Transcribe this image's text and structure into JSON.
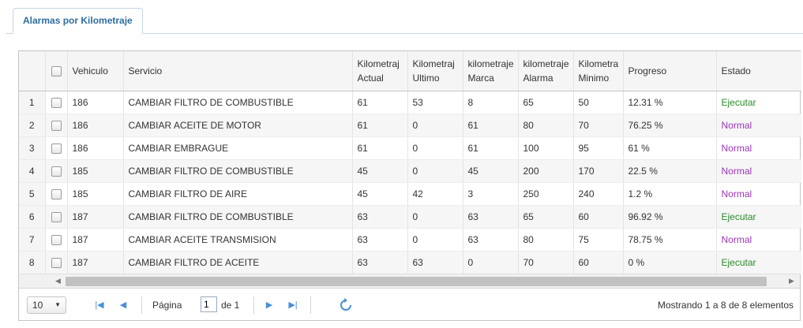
{
  "tab": {
    "label": "Alarmas por Kilometraje"
  },
  "columns": [
    {
      "l1": "",
      "l2": ""
    },
    {
      "l1": "",
      "l2": ""
    },
    {
      "l1": "Vehiculo",
      "l2": ""
    },
    {
      "l1": "Servicio",
      "l2": ""
    },
    {
      "l1": "Kilometraj",
      "l2": "Actual"
    },
    {
      "l1": "Kilometraj",
      "l2": "Ultimo"
    },
    {
      "l1": "kilometraje",
      "l2": "Marca"
    },
    {
      "l1": "kilometraje",
      "l2": "Alarma"
    },
    {
      "l1": "Kilometraj",
      "l2": "Minimo"
    },
    {
      "l1": "Progreso",
      "l2": ""
    },
    {
      "l1": "Estado",
      "l2": ""
    }
  ],
  "rows": [
    {
      "n": "1",
      "vehiculo": "186",
      "servicio": "CAMBIAR FILTRO DE COMBUSTIBLE",
      "actual": "61",
      "ultimo": "53",
      "marca": "8",
      "alarma": "65",
      "minimo": "50",
      "progreso": "12.31 %",
      "estado": "Ejecutar"
    },
    {
      "n": "2",
      "vehiculo": "186",
      "servicio": "CAMBIAR ACEITE DE MOTOR",
      "actual": "61",
      "ultimo": "0",
      "marca": "61",
      "alarma": "80",
      "minimo": "70",
      "progreso": "76.25 %",
      "estado": "Normal"
    },
    {
      "n": "3",
      "vehiculo": "186",
      "servicio": "CAMBIAR EMBRAGUE",
      "actual": "61",
      "ultimo": "0",
      "marca": "61",
      "alarma": "100",
      "minimo": "95",
      "progreso": "61 %",
      "estado": "Normal"
    },
    {
      "n": "4",
      "vehiculo": "185",
      "servicio": "CAMBIAR FILTRO DE COMBUSTIBLE",
      "actual": "45",
      "ultimo": "0",
      "marca": "45",
      "alarma": "200",
      "minimo": "170",
      "progreso": "22.5 %",
      "estado": "Normal"
    },
    {
      "n": "5",
      "vehiculo": "185",
      "servicio": "CAMBIAR FILTRO DE AIRE",
      "actual": "45",
      "ultimo": "42",
      "marca": "3",
      "alarma": "250",
      "minimo": "240",
      "progreso": "1.2 %",
      "estado": "Normal"
    },
    {
      "n": "6",
      "vehiculo": "187",
      "servicio": "CAMBIAR FILTRO DE COMBUSTIBLE",
      "actual": "63",
      "ultimo": "0",
      "marca": "63",
      "alarma": "65",
      "minimo": "60",
      "progreso": "96.92 %",
      "estado": "Ejecutar"
    },
    {
      "n": "7",
      "vehiculo": "187",
      "servicio": "CAMBIAR ACEITE TRANSMISION",
      "actual": "63",
      "ultimo": "0",
      "marca": "63",
      "alarma": "80",
      "minimo": "75",
      "progreso": "78.75 %",
      "estado": "Normal"
    },
    {
      "n": "8",
      "vehiculo": "187",
      "servicio": "CAMBIAR FILTRO DE ACEITE",
      "actual": "63",
      "ultimo": "63",
      "marca": "0",
      "alarma": "70",
      "minimo": "60",
      "progreso": "0 %",
      "estado": "Ejecutar"
    }
  ],
  "status_colors": {
    "Ejecutar": "#2a8a2a",
    "Normal": "#9b36b6"
  },
  "pager": {
    "page_size": "10",
    "page_label": "Página",
    "page_value": "1",
    "of_label": "de 1",
    "info": "Mostrando 1 a 8 de 8 elementos"
  }
}
